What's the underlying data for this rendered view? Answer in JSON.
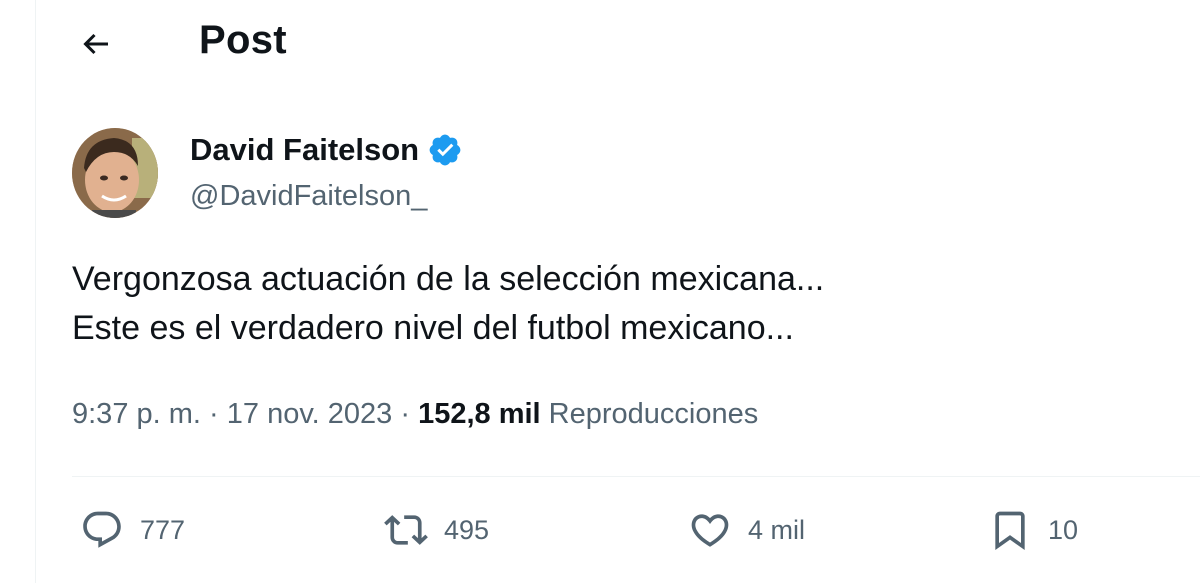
{
  "header": {
    "title": "Post",
    "back_icon": "arrow-left-icon"
  },
  "author": {
    "name": "David Faitelson",
    "handle": "@DavidFaitelson_",
    "verified_icon": "verified-badge-icon",
    "verified_color": "#1d9bf0"
  },
  "tweet": {
    "lines": [
      "Vergonzosa actuación de la selección mexicana...",
      "Este es el verdadero nivel del futbol mexicano..."
    ],
    "time": "9:37 p. m.",
    "separator": " · ",
    "date": "17 nov. 2023",
    "views_count": "152,8 mil",
    "views_label": "Reproducciones"
  },
  "actions": {
    "replies": {
      "icon": "reply-icon",
      "count": "777"
    },
    "reposts": {
      "icon": "repost-icon",
      "count": "495"
    },
    "likes": {
      "icon": "heart-icon",
      "count": "4 mil"
    },
    "bookmarks": {
      "icon": "bookmark-icon",
      "count": "10"
    }
  },
  "colors": {
    "text": "#0f1419",
    "secondary": "#536471",
    "accent": "#1d9bf0",
    "border": "#eff3f4"
  }
}
